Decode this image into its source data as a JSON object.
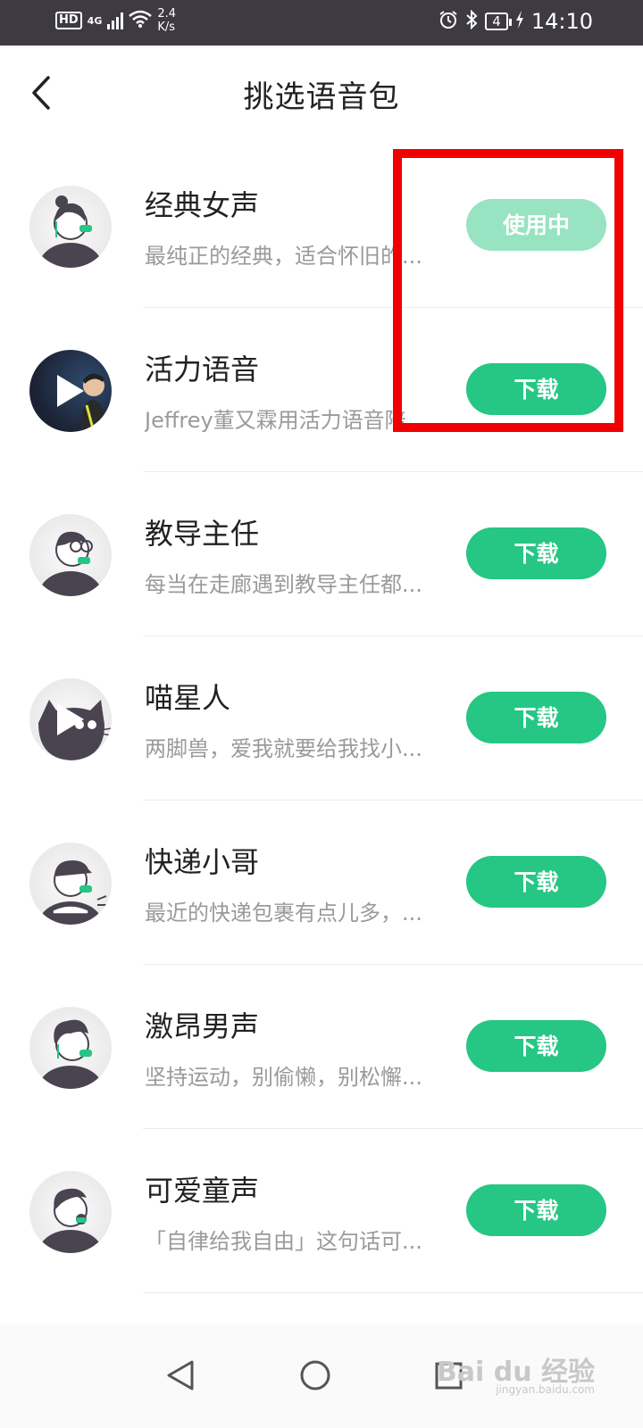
{
  "status_bar": {
    "hd": "HD",
    "network": "4G",
    "speed_value": "2.4",
    "speed_unit": "K/s",
    "battery": "4",
    "time": "14:10"
  },
  "header": {
    "title": "挑选语音包"
  },
  "voice_packs": [
    {
      "title": "经典女声",
      "subtitle": "最纯正的经典，适合怀旧的...",
      "button": "使用中",
      "state": "in-use"
    },
    {
      "title": "活力语音",
      "subtitle": "Jeffrey董又霖用活力语音陪...",
      "button": "下载",
      "state": "download"
    },
    {
      "title": "教导主任",
      "subtitle": "每当在走廊遇到教导主任都...",
      "button": "下载",
      "state": "download"
    },
    {
      "title": "喵星人",
      "subtitle": "两脚兽，爱我就要给我找小...",
      "button": "下载",
      "state": "download"
    },
    {
      "title": "快递小哥",
      "subtitle": "最近的快递包裹有点儿多，...",
      "button": "下载",
      "state": "download"
    },
    {
      "title": "激昂男声",
      "subtitle": "坚持运动，别偷懒，别松懈...",
      "button": "下载",
      "state": "download"
    },
    {
      "title": "可爱童声",
      "subtitle": "「自律给我自由」这句话可...",
      "button": "下载",
      "state": "download"
    }
  ],
  "colors": {
    "accent": "#26c684",
    "accent_disabled": "#97e3c2",
    "highlight": "#f00000"
  },
  "watermark": {
    "text": "Bai du 经验",
    "sub": "jingyan.baidu.com"
  }
}
